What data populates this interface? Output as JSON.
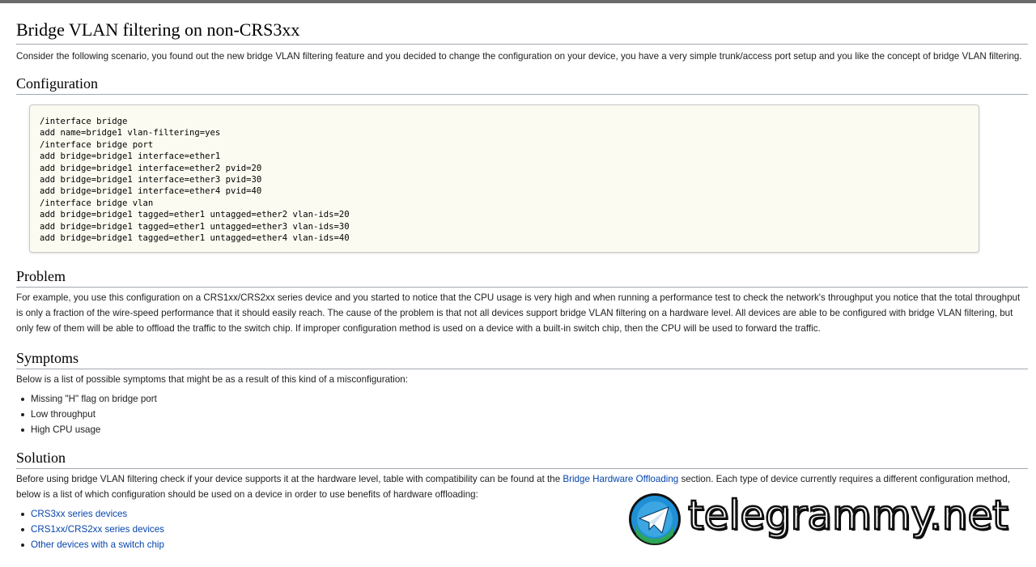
{
  "page": {
    "title": "Bridge VLAN filtering on non-CRS3xx",
    "intro": "Consider the following scenario, you found out the new bridge VLAN filtering feature and you decided to change the configuration on your device, you have a very simple trunk/access port setup and you like the concept of bridge VLAN filtering."
  },
  "configuration": {
    "heading": "Configuration",
    "code": "/interface bridge\nadd name=bridge1 vlan-filtering=yes\n/interface bridge port\nadd bridge=bridge1 interface=ether1\nadd bridge=bridge1 interface=ether2 pvid=20\nadd bridge=bridge1 interface=ether3 pvid=30\nadd bridge=bridge1 interface=ether4 pvid=40\n/interface bridge vlan\nadd bridge=bridge1 tagged=ether1 untagged=ether2 vlan-ids=20\nadd bridge=bridge1 tagged=ether1 untagged=ether3 vlan-ids=30\nadd bridge=bridge1 tagged=ether1 untagged=ether4 vlan-ids=40"
  },
  "problem": {
    "heading": "Problem",
    "text": "For example, you use this configuration on a CRS1xx/CRS2xx series device and you started to notice that the CPU usage is very high and when running a performance test to check the network's throughput you notice that the total throughput is only a fraction of the wire-speed performance that it should easily reach. The cause of the problem is that not all devices support bridge VLAN filtering on a hardware level. All devices are able to be configured with bridge VLAN filtering, but only few of them will be able to offload the traffic to the switch chip. If improper configuration method is used on a device with a built-in switch chip, then the CPU will be used to forward the traffic."
  },
  "symptoms": {
    "heading": "Symptoms",
    "text": "Below is a list of possible symptoms that might be as a result of this kind of a misconfiguration:",
    "items": [
      "Missing \"H\" flag on bridge port",
      "Low throughput",
      "High CPU usage"
    ]
  },
  "solution": {
    "heading": "Solution",
    "text_before": "Before using bridge VLAN filtering check if your device supports it at the hardware level, table with compatibility can be found at the ",
    "link": "Bridge Hardware Offloading",
    "text_after": " section. Each type of device currently requires a different configuration method, below is a list of which configuration should be used on a device in order to use benefits of hardware offloading:",
    "links": [
      "CRS3xx series devices",
      "CRS1xx/CRS2xx series devices",
      "Other devices with a switch chip"
    ]
  },
  "watermark": {
    "text": "telegrammy.net",
    "icon": "paper-plane-icon",
    "colors": {
      "outer": "#1f8fd6",
      "inner": "#2fa94e",
      "plane": "#ffffff"
    }
  },
  "colors": {
    "link": "#0645ad",
    "text": "#202122",
    "code_bg": "#fbfbf1",
    "rule": "#a2a9b1"
  }
}
